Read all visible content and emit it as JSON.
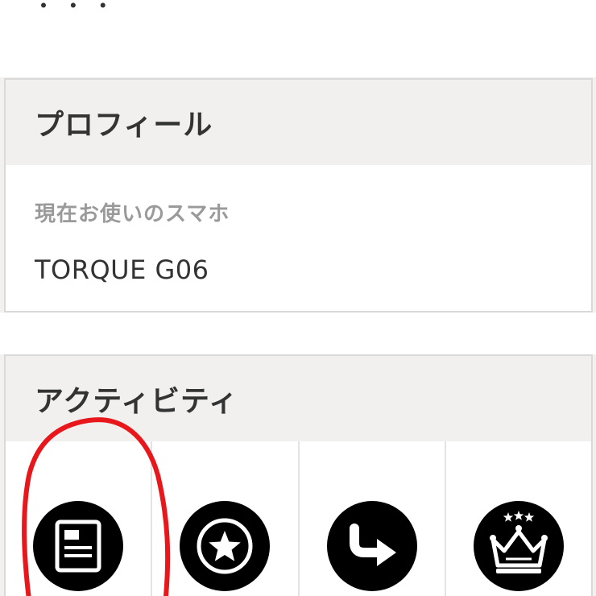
{
  "top": {
    "cutoff_text": "・ ・ ・"
  },
  "profile": {
    "title": "プロフィール",
    "phone_label": "現在お使いのスマホ",
    "phone_value": "TORQUE G06"
  },
  "activity": {
    "title": "アクティビティ",
    "items": [
      {
        "icon": "article-icon"
      },
      {
        "icon": "star-badge-icon"
      },
      {
        "icon": "share-arrow-icon"
      },
      {
        "icon": "crown-icon"
      }
    ]
  },
  "colors": {
    "background": "#f2f1f0",
    "header": "#f1f0ef",
    "annotation": "#e8171b",
    "icon": "#000000"
  }
}
